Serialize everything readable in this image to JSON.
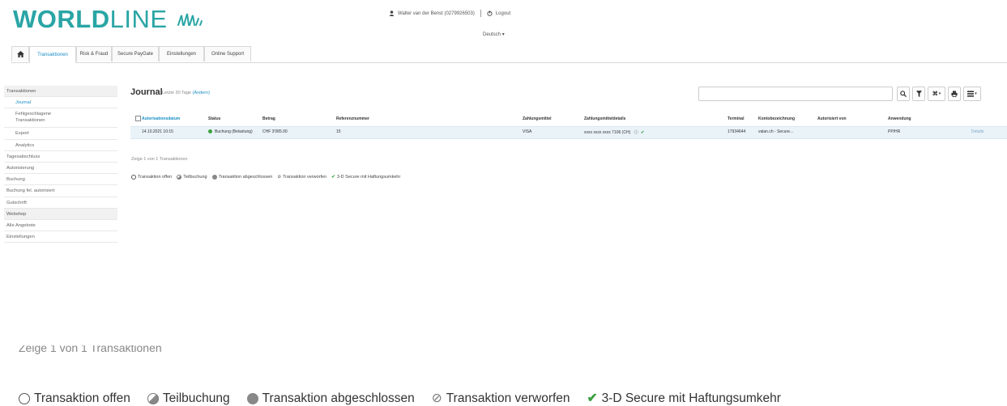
{
  "brand": {
    "name_bold": "WORLD",
    "name_thin": "LINE"
  },
  "header": {
    "user": "Walter van der Benst (0279926503)",
    "logout": "Logout",
    "language": "Deutsch"
  },
  "nav": {
    "tabs": [
      "Transaktionen",
      "Risk & Fraud",
      "Secure PayGate",
      "Einstellungen",
      "Online Support"
    ]
  },
  "sidebar": {
    "items": [
      {
        "label": "Transaktionen"
      },
      {
        "label": "Journal"
      },
      {
        "label": "Fehlgeschlagene",
        "label2": "Transaktionen"
      },
      {
        "label": "Export"
      },
      {
        "label": "Analytics"
      },
      {
        "label": "Tagesabschluss"
      },
      {
        "label": "Autorisierung"
      },
      {
        "label": "Buchung"
      },
      {
        "label": "Buchung fel. autorisiert"
      },
      {
        "label": "Gutschrift"
      },
      {
        "label": "Webshop"
      },
      {
        "label": "Alle Angebote"
      },
      {
        "label": "Einstellungen"
      }
    ]
  },
  "journal": {
    "title": "Journal",
    "subtitle": "Letzte 30 Tage",
    "change_link": "(Ändern)"
  },
  "search": {
    "placeholder": ""
  },
  "table": {
    "headers": [
      "Autorisationsdatum",
      "Status",
      "Betrag",
      "Referenznummer",
      "Zahlungsmittel",
      "Zahlungsmitteldetails",
      "Terminal",
      "Kontobezeichnung",
      "Autorisiert von",
      "Anwendung"
    ],
    "rows": [
      {
        "date": "14.10.2021 10:15",
        "status": "Buchung (Belastung)",
        "amount": "CHF 3'085.00",
        "reference": "15",
        "method": "VISA",
        "method_details": "xxxx xxxx xxxx 7106 (CH)",
        "terminal": "17934644",
        "account": "valan.ch - Secure...",
        "authorized_by": "",
        "application": "PP/HR",
        "details": "Details"
      }
    ]
  },
  "count_text": "Zeige 1 von 1 Transaktionen",
  "legend": {
    "open": "Transaktion offen",
    "partial": "Teilbuchung",
    "closed": "Transaktion abgeschlossen",
    "discarded": "Transaktion verworfen",
    "secure": "3-D Secure mit Haftungsumkehr"
  },
  "colors": {
    "brand": "#2aa5a5",
    "link": "#1a8ec4",
    "success": "#3ca040",
    "row_highlight": "#e9f3f8"
  }
}
